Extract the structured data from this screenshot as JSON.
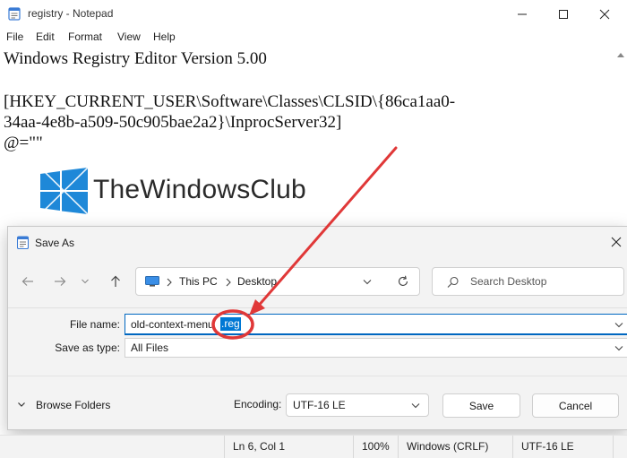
{
  "notepad": {
    "title": "registry - Notepad",
    "menu": [
      "File",
      "Edit",
      "Format",
      "View",
      "Help"
    ],
    "lines": [
      "Windows Registry Editor Version 5.00",
      "",
      "[HKEY_CURRENT_USER\\Software\\Classes\\CLSID\\{86ca1aa0-",
      "34aa-4e8b-a509-50c905bae2a2}\\InprocServer32]",
      "@=\"\""
    ],
    "status": {
      "position": "Ln 6, Col 1",
      "zoom": "100%",
      "line_ending": "Windows (CRLF)",
      "encoding": "UTF-16 LE"
    }
  },
  "watermark": {
    "text": "TheWindowsClub",
    "color": "#1e88d8"
  },
  "save_dialog": {
    "title": "Save As",
    "path": [
      "This PC",
      "Desktop"
    ],
    "search_placeholder": "Search Desktop",
    "file_name_label": "File name:",
    "file_name_value": "old-context-menu",
    "file_name_selected": ".reg",
    "save_as_type_label": "Save as type:",
    "save_as_type_value": "All Files",
    "browse_folders": "Browse Folders",
    "encoding_label": "Encoding:",
    "encoding_value": "UTF-16 LE",
    "save_button": "Save",
    "cancel_button": "Cancel"
  },
  "annotation": {
    "color": "#e03838",
    "type": "arrow-and-circle"
  },
  "colors": {
    "accent": "#0067c0",
    "selection": "#0078d4"
  }
}
